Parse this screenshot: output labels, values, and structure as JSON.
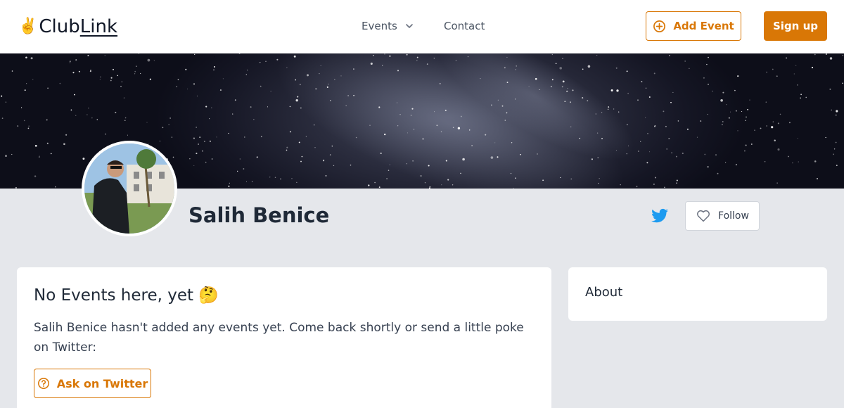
{
  "header": {
    "logo_emoji": "✌️",
    "logo_text_club": "Club",
    "logo_text_link": "Link",
    "nav": {
      "events_label": "Events",
      "contact_label": "Contact"
    },
    "add_event_label": "Add Event",
    "sign_up_label": "Sign up"
  },
  "profile": {
    "name": "Salih Benice",
    "follow_label": "Follow"
  },
  "events_card": {
    "title": "No Events here, yet 🤔",
    "message": "Salih Benice hasn't added any events yet. Come back shortly or send a little poke on Twitter:",
    "ask_button_label": "Ask on Twitter"
  },
  "about_card": {
    "title": "About"
  },
  "colors": {
    "accent": "#d97706",
    "twitter": "#1d9bf0",
    "page_bg": "#e5e7eb"
  },
  "icons": {
    "add_event": "plus-circle-icon",
    "events_dropdown": "chevron-down-icon",
    "twitter": "twitter-icon",
    "follow": "heart-icon",
    "ask": "question-circle-icon"
  }
}
